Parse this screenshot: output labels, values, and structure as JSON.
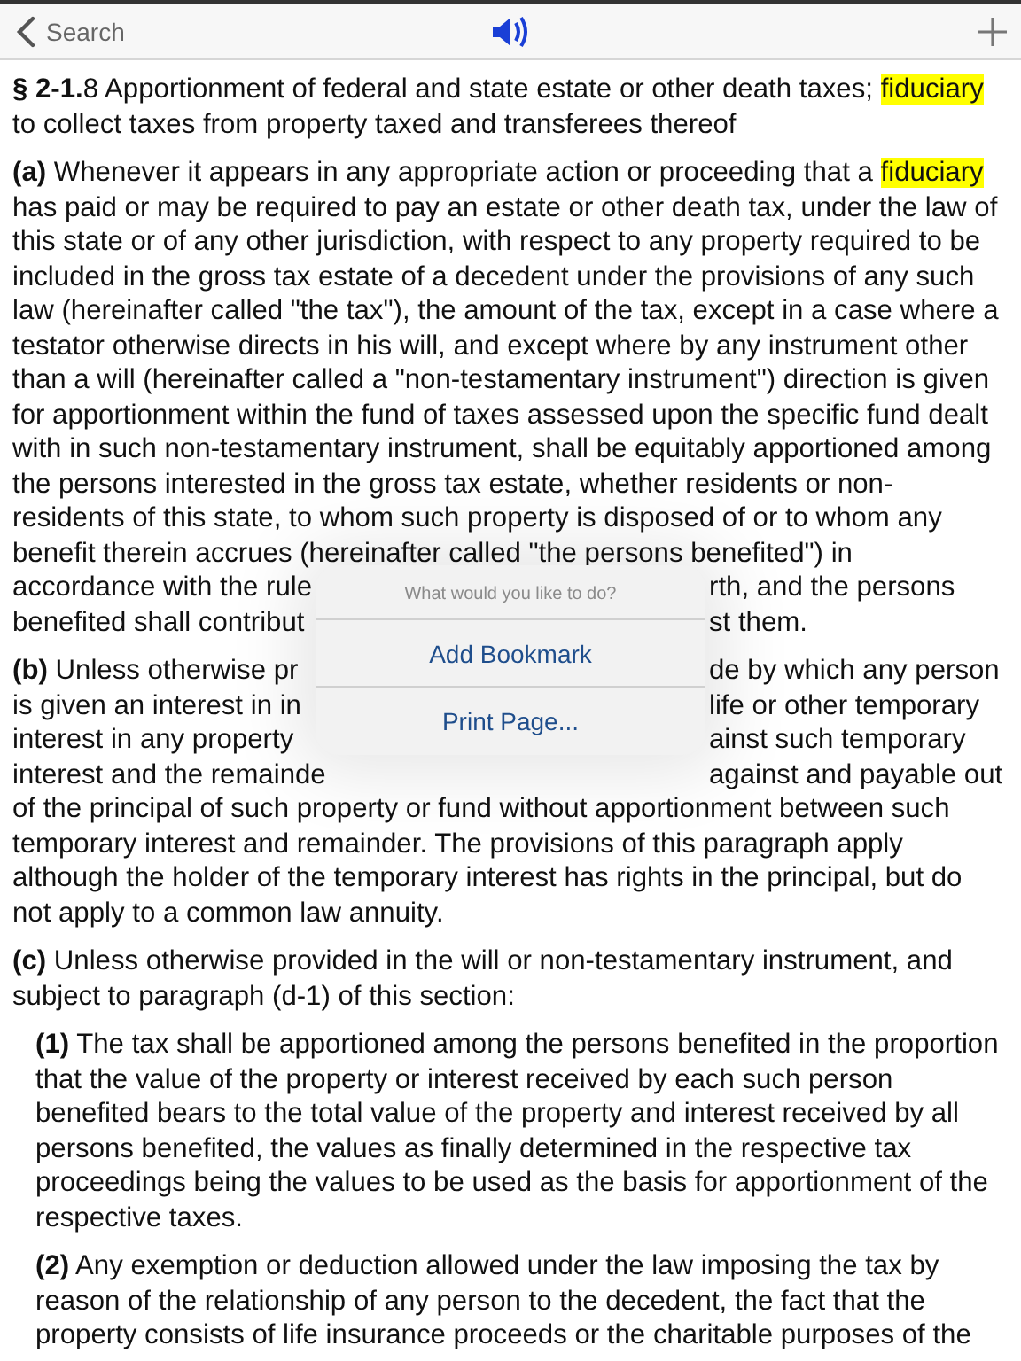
{
  "nav_bar": {
    "back_label": "Search"
  },
  "paragraphs": [
    {
      "nested": false,
      "lines": [
        {
          "segments": [
            {
              "text": "§ 2-1.",
              "kind": "label"
            },
            {
              "text": "8 Apportionment of federal and state estate or other death taxes; ",
              "kind": "plain"
            },
            {
              "text": "fiduciary",
              "kind": "highlight"
            }
          ]
        },
        {
          "segments": [
            {
              "text": "to collect taxes from property taxed and transferees thereof",
              "kind": "plain"
            }
          ]
        }
      ]
    },
    {
      "nested": false,
      "lines": [
        {
          "segments": [
            {
              "text": "(a)",
              "kind": "label"
            },
            {
              "text": " Whenever it appears in any appropriate action or proceeding that a ",
              "kind": "plain"
            },
            {
              "text": "fiduciary",
              "kind": "highlight"
            }
          ]
        },
        {
          "segments": [
            {
              "text": "has paid or may be required to pay an estate or other death tax, under the law of",
              "kind": "plain"
            }
          ]
        },
        {
          "segments": [
            {
              "text": "this state or of any other jurisdiction, with respect to any property required to be",
              "kind": "plain"
            }
          ]
        },
        {
          "segments": [
            {
              "text": "included in the gross tax estate of a decedent under the provisions of any such",
              "kind": "plain"
            }
          ]
        },
        {
          "segments": [
            {
              "text": "law (hereinafter called \"the tax\"), the amount of the tax, except in a case where a",
              "kind": "plain"
            }
          ]
        },
        {
          "segments": [
            {
              "text": "testator otherwise directs in his will, and except where by any instrument other",
              "kind": "plain"
            }
          ]
        },
        {
          "segments": [
            {
              "text": "than a will (hereinafter called a \"non-testamentary instrument\") direction is given",
              "kind": "plain"
            }
          ]
        },
        {
          "segments": [
            {
              "text": "for apportionment within the fund of taxes assessed upon the specific fund dealt",
              "kind": "plain"
            }
          ]
        },
        {
          "segments": [
            {
              "text": "with in such non-testamentary instrument, shall be equitably apportioned among",
              "kind": "plain"
            }
          ]
        },
        {
          "segments": [
            {
              "text": "the persons interested in the gross tax estate, whether residents or non-",
              "kind": "plain"
            }
          ]
        },
        {
          "segments": [
            {
              "text": "residents of this state, to whom such property is disposed of or to whom any",
              "kind": "plain"
            }
          ]
        },
        {
          "segments": [
            {
              "text": "benefit therein accrues (hereinafter called \"the persons benefited\") in",
              "kind": "plain"
            }
          ]
        },
        {
          "left": [
            {
              "text": "accordance with the rule",
              "kind": "plain"
            }
          ],
          "right": [
            {
              "text": "rth, and the persons",
              "kind": "plain"
            }
          ]
        },
        {
          "left": [
            {
              "text": "benefited shall contribut",
              "kind": "plain"
            }
          ],
          "right": [
            {
              "text": "st them.",
              "kind": "plain"
            }
          ]
        }
      ]
    },
    {
      "nested": false,
      "lines": [
        {
          "left": [
            {
              "text": "(b)",
              "kind": "label"
            },
            {
              "text": " Unless otherwise pr",
              "kind": "plain"
            }
          ],
          "right": [
            {
              "text": "de by which any person",
              "kind": "plain"
            }
          ]
        },
        {
          "left": [
            {
              "text": "is given an interest in in",
              "kind": "plain"
            }
          ],
          "right": [
            {
              "text": "life or other temporary",
              "kind": "plain"
            }
          ]
        },
        {
          "left": [
            {
              "text": "interest in any property",
              "kind": "plain"
            }
          ],
          "right": [
            {
              "text": "ainst such temporary",
              "kind": "plain"
            }
          ]
        },
        {
          "left": [
            {
              "text": "interest and the remainde",
              "kind": "plain"
            }
          ],
          "right": [
            {
              "text": "against and payable out",
              "kind": "plain"
            }
          ]
        },
        {
          "segments": [
            {
              "text": "of the principal of such property or fund without apportionment between such",
              "kind": "plain"
            }
          ]
        },
        {
          "segments": [
            {
              "text": "temporary interest and remainder. The provisions of this paragraph apply",
              "kind": "plain"
            }
          ]
        },
        {
          "segments": [
            {
              "text": "although the holder of the temporary interest has rights in the principal, but do",
              "kind": "plain"
            }
          ]
        },
        {
          "segments": [
            {
              "text": "not apply to a common law annuity.",
              "kind": "plain"
            }
          ]
        }
      ]
    },
    {
      "nested": false,
      "lines": [
        {
          "segments": [
            {
              "text": "(c)",
              "kind": "label"
            },
            {
              "text": " Unless otherwise provided in the will or non-testamentary instrument, and",
              "kind": "plain"
            }
          ]
        },
        {
          "segments": [
            {
              "text": "subject to paragraph (d-1) of this section:",
              "kind": "plain"
            }
          ]
        }
      ]
    },
    {
      "nested": true,
      "lines": [
        {
          "segments": [
            {
              "text": "(1)",
              "kind": "label"
            },
            {
              "text": " The tax shall be apportioned among the persons benefited in the proportion",
              "kind": "plain"
            }
          ]
        },
        {
          "segments": [
            {
              "text": "that the value of the property or interest received by each such person",
              "kind": "plain"
            }
          ]
        },
        {
          "segments": [
            {
              "text": "benefited bears to the total value of the property and interest received by all",
              "kind": "plain"
            }
          ]
        },
        {
          "segments": [
            {
              "text": "persons benefited, the values as finally determined in the respective tax",
              "kind": "plain"
            }
          ]
        },
        {
          "segments": [
            {
              "text": "proceedings being the values to be used as the basis for apportionment of the",
              "kind": "plain"
            }
          ]
        },
        {
          "segments": [
            {
              "text": "respective taxes.",
              "kind": "plain"
            }
          ]
        }
      ]
    },
    {
      "nested": true,
      "lines": [
        {
          "segments": [
            {
              "text": "(2)",
              "kind": "label"
            },
            {
              "text": " Any exemption or deduction allowed under the law imposing the tax by",
              "kind": "plain"
            }
          ]
        },
        {
          "segments": [
            {
              "text": "reason of the relationship of any person to the decedent, the fact that the",
              "kind": "plain"
            }
          ]
        },
        {
          "segments": [
            {
              "text": "property consists of life insurance proceeds or the charitable purposes of the",
              "kind": "plain"
            }
          ]
        }
      ]
    }
  ],
  "action_sheet": {
    "title": "What would you like to do?",
    "actions": [
      "Add Bookmark",
      "Print Page..."
    ]
  }
}
